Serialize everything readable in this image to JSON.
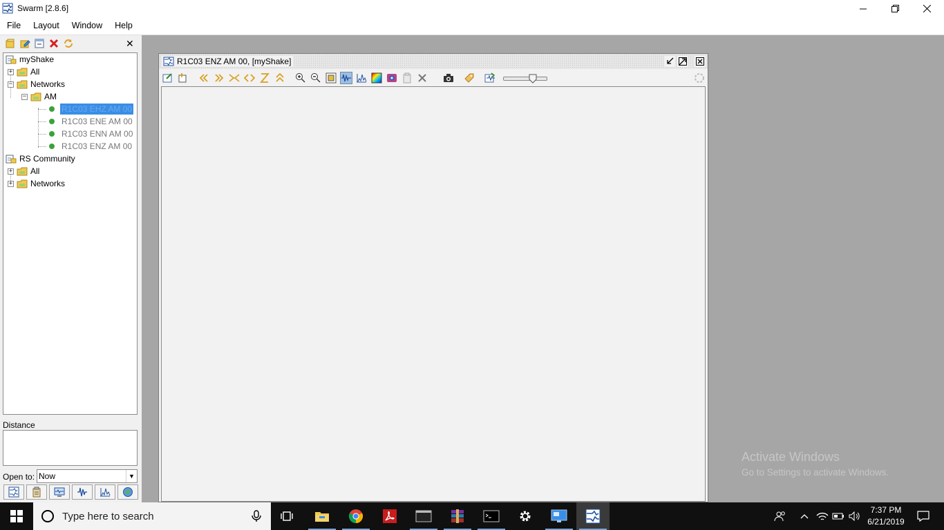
{
  "window": {
    "title": "Swarm [2.8.6]"
  },
  "menubar": {
    "items": [
      {
        "label": "File"
      },
      {
        "label": "Layout"
      },
      {
        "label": "Window"
      },
      {
        "label": "Help"
      }
    ]
  },
  "left_panel": {
    "toolbar_icons": [
      "open-data-source-icon",
      "edit-data-source-icon",
      "collapse-icon",
      "remove-icon",
      "refresh-icon"
    ],
    "close_symbol": "✕",
    "tree": {
      "mySource": "myShake",
      "myAll": "All",
      "myNetworks": "Networks",
      "am": "AM",
      "channels": [
        {
          "label": "R1C03 EHZ AM 00",
          "selected": true
        },
        {
          "label": "R1C03 ENE AM 00",
          "selected": false
        },
        {
          "label": "R1C03 ENN AM 00",
          "selected": false
        },
        {
          "label": "R1C03 ENZ AM 00",
          "selected": false
        }
      ],
      "rsSource": "RS Community",
      "rsAll": "All",
      "rsNetworks": "Networks"
    },
    "distance_label": "Distance",
    "open_to_label": "Open to:",
    "open_to_value": "Now",
    "bottom_buttons": [
      "wave-clipboard-icon",
      "clipboard-icon",
      "monitor-icon",
      "helicorder-icon",
      "spectra-icon",
      "map-icon"
    ]
  },
  "helicorder_frame": {
    "title": "R1C03 ENZ AM 00, [myShake]",
    "toolbar_icons": [
      "settings-icon",
      "copy-icon",
      "scroll-back-icon",
      "scroll-forward-icon",
      "compress-icon",
      "expand-icon",
      "timeslice-icon",
      "gulper-icon",
      "zoom-in-icon",
      "zoom-out-icon",
      "fit-icon",
      "waveform-icon",
      "spectra-icon",
      "spectrogram-icon",
      "particle-motion-icon",
      "clipboard-icon",
      "close-wave-icon",
      "capture-icon",
      "pick-icon",
      "throbber-icon"
    ],
    "slider_value_fraction": 0.72
  },
  "watermark": {
    "line1": "Activate Windows",
    "line2": "Go to Settings to activate Windows."
  },
  "taskbar": {
    "search_placeholder": "Type here to search",
    "apps": [
      "task-view-icon",
      "file-explorer-icon",
      "chrome-icon",
      "acrobat-icon",
      "terminal-icon",
      "winrar-icon",
      "cmd-icon",
      "settings-icon",
      "remote-desktop-icon",
      "swarm-icon"
    ],
    "time": "7:37 PM",
    "date": "6/21/2019"
  },
  "colors": {
    "selection": "#3a8ee6",
    "desktop_bg": "#a6a6a6",
    "taskbar_bg": "#101010",
    "channel_dot": "#3aa23a"
  }
}
